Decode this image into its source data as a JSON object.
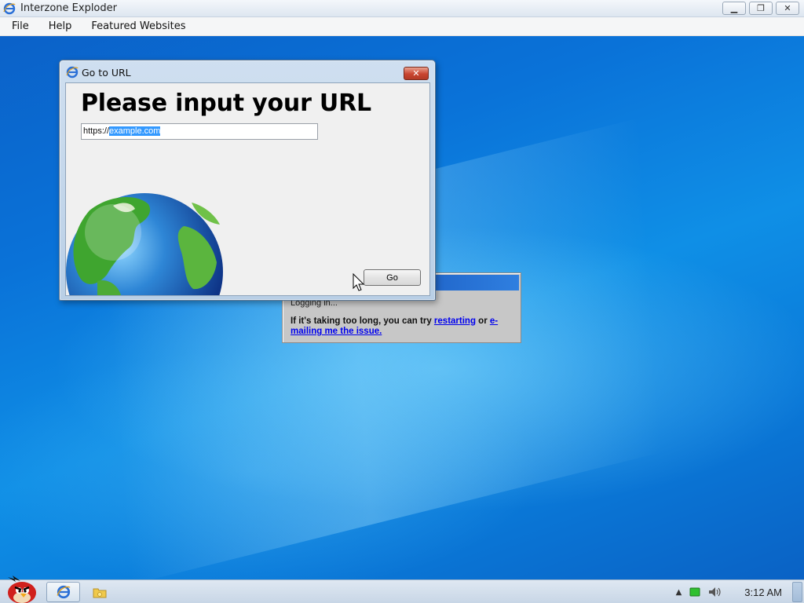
{
  "app": {
    "title": "Interzone Exploder",
    "window_buttons": [
      "minimize",
      "restore",
      "close"
    ]
  },
  "menubar": {
    "items": [
      "File",
      "Help",
      "Featured Websites"
    ]
  },
  "login_dialog": {
    "status": "Logging in...",
    "message_prefix": "If it's taking too long, you can try ",
    "restart_link": "restarting",
    "or_text": " or ",
    "email_link": "e-mailing me the issue."
  },
  "url_dialog": {
    "title": "Go to URL",
    "heading": "Please input your URL",
    "input_prefix": "https://",
    "input_selected": "example.com",
    "go_label": "Go",
    "close_label": "✕"
  },
  "taskbar": {
    "clock": "3:12 AM"
  },
  "colors": {
    "selection": "#3399ff",
    "link": "#0000ee",
    "close_red": "#c94530"
  }
}
